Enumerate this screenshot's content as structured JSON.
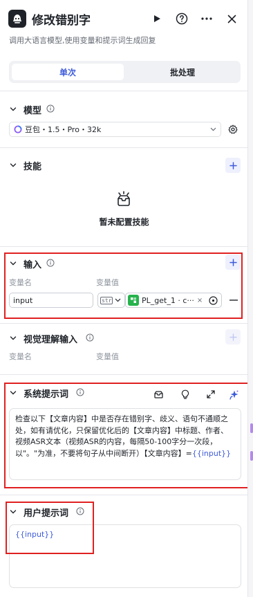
{
  "header": {
    "title": "修改错别字",
    "subtitle": "调用大语言模型,使用变量和提示词生成回复",
    "icons": [
      "play-icon",
      "help-icon",
      "more-icon",
      "close-icon"
    ]
  },
  "mode_tabs": [
    "单次",
    "批处理"
  ],
  "model": {
    "label": "模型",
    "selected": "豆包・1.5・Pro・32k"
  },
  "skills": {
    "label": "技能",
    "empty_text": "暂未配置技能"
  },
  "input": {
    "label": "输入",
    "col_name": "变量名",
    "col_value": "变量值",
    "rows": [
      {
        "name": "input",
        "type": "str",
        "ref": "PL_get_1 · c···"
      }
    ]
  },
  "visual_input": {
    "label": "视觉理解输入",
    "col_name": "变量名",
    "col_value": "变量值"
  },
  "system_prompt": {
    "label": "系统提示词",
    "text": "检查以下【文章内容】中是否存在错别字、歧义、语句不通顺之处，如有请优化，只保留优化后的【文章内容】中标题、作者、视频ASR文本（视频ASR的内容，每隔50-100字分一次段，以\"。\"为准，不要将句子从中间断开）【文章内容】=",
    "variable": "{{input}}"
  },
  "user_prompt": {
    "label": "用户提示词",
    "text": "{{input}}"
  },
  "colors": {
    "accent": "#3d5bd9",
    "highlight_box": "#e02020",
    "ref_icon": "#26b24c"
  }
}
